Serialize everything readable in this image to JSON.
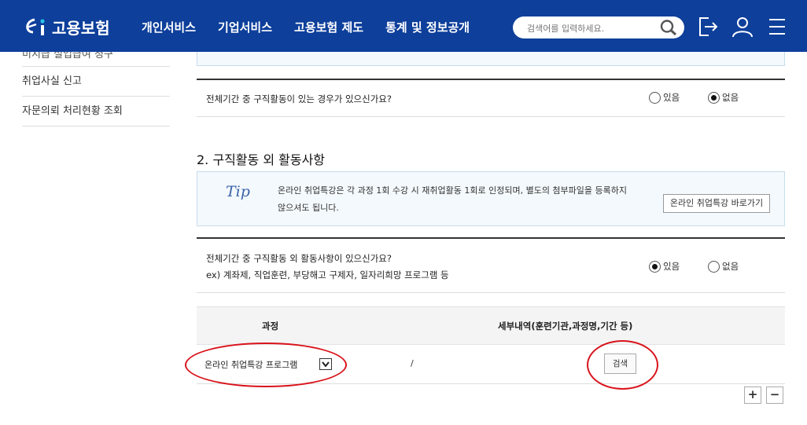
{
  "header": {
    "logo_text": "고용보험",
    "nav": [
      "개인서비스",
      "기업서비스",
      "고용보험 제도",
      "통계 및 정보공개"
    ],
    "search_placeholder": "검색어를 입력하세요.",
    "brand_color": "#0d3f9b"
  },
  "sidebar": {
    "items": [
      "미지급 실업급여 청구",
      "취업사실 신고",
      "자문의뢰 처리현황 조회"
    ]
  },
  "q1": {
    "text": "전체기간 중 구직활동이 있는 경우가 있으신가요?",
    "options": [
      "있음",
      "없음"
    ],
    "selected": "없음"
  },
  "section2": {
    "title": "2. 구직활동 외 활동사항",
    "tip_label": "Tip",
    "tip_text": "온라인 취업특강은 각 과정 1회 수강 시 재취업활동 1회로 인정되며, 별도의 첨부파일을 등록하지 않으셔도 됩니다.",
    "tip_button": "온라인 취업특강 바로가기"
  },
  "q2": {
    "line1": "전체기간 중 구직활동 외 활동사항이 있으신가요?",
    "line2": "ex) 계좌제, 직업훈련, 부당해고 구제자, 일자리희망 프로그램 등",
    "options": [
      "있음",
      "없음"
    ],
    "selected": "있음"
  },
  "table": {
    "col1": "과정",
    "col2": "세부내역(훈련기관,과정명,기간 등)",
    "select_value": "온라인 취업특강 프로그램",
    "separator": "/",
    "search_button": "검색",
    "add_button": "+",
    "remove_button": "−"
  },
  "highlight_color": "#d9141c"
}
